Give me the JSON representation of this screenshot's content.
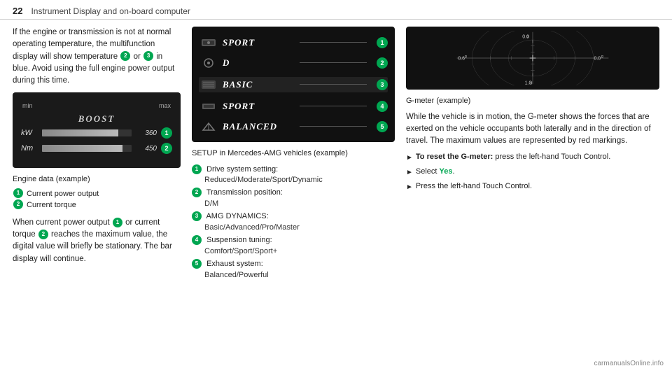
{
  "header": {
    "page_number": "22",
    "title": "Instrument Display and on-board computer"
  },
  "left_col": {
    "intro_text": "If the engine or transmission is not at normal operating temperature, the multifunction display will show temperature",
    "intro_text2": "or",
    "intro_text3": "in blue. Avoid using the full engine power output during this time.",
    "boost_label": "BOOST",
    "boost_min": "min",
    "boost_max": "max",
    "bar1_label": "kW",
    "bar1_value": "360",
    "bar1_badge": "1",
    "bar2_label": "Nm",
    "bar2_value": "450",
    "bar2_badge": "2",
    "engine_caption": "Engine data (example)",
    "engine_item1": "Current power output",
    "engine_item2": "Current torque",
    "when_text": "When current power output",
    "when_text2": "or current torque",
    "when_text3": "reaches the maximum value, the digital value will briefly be stationary. The bar display will continue."
  },
  "middle_col": {
    "setup_rows": [
      {
        "icon": "🐎",
        "value": "SPORT",
        "num": "1"
      },
      {
        "icon": "⚙️",
        "value": "D",
        "num": "2"
      },
      {
        "icon": "💫",
        "value": "BASIC",
        "num": "3"
      },
      {
        "icon": "🔧",
        "value": "SPORT",
        "num": "4"
      },
      {
        "icon": "⚖️",
        "value": "BALANCED",
        "num": "5"
      }
    ],
    "setup_caption": "SETUP in Mercedes-AMG vehicles (example)",
    "setup_items": [
      {
        "num": "1",
        "label": "Drive system setting:",
        "sub": "Reduced/Moderate/Sport/Dynamic"
      },
      {
        "num": "2",
        "label": "Transmission position:",
        "sub": "D/M"
      },
      {
        "num": "3",
        "label": "AMG DYNAMICS:",
        "sub": "Basic/Advanced/Pro/Master"
      },
      {
        "num": "4",
        "label": "Suspension tuning:",
        "sub": "Comfort/Sport/Sport+"
      },
      {
        "num": "5",
        "label": "Exhaust system:",
        "sub": "Balanced/Powerful"
      }
    ]
  },
  "right_col": {
    "gmeter_caption": "G-meter (example)",
    "gmeter_top": "0.0",
    "gmeter_top_sub": "g",
    "gmeter_bottom": "1.0",
    "gmeter_bottom_sub": "g",
    "gmeter_left": "0.6",
    "gmeter_left_sub": "g",
    "gmeter_right": "0.0",
    "gmeter_right_sub": "g",
    "gmeter_text": "While the vehicle is in motion, the G-meter shows the forces that are exerted on the vehicle occupants both laterally and in the direction of travel. The maximum values are represented by red markings.",
    "arrow1_bold": "To reset the G-meter:",
    "arrow1_text": " press the left-hand Touch Control.",
    "arrow2_bold": "Select ",
    "arrow2_green": "Yes",
    "arrow2_text": ".",
    "arrow3_text": "Press the left-hand Touch Control."
  },
  "watermark": "carmanualsOnline.info"
}
